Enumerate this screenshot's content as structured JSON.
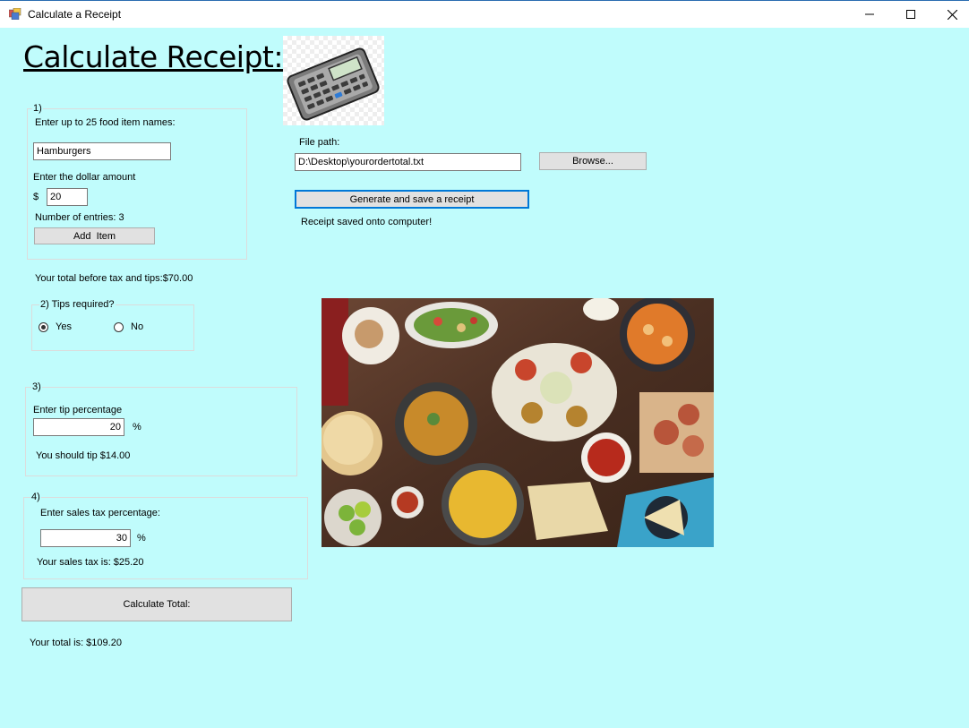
{
  "window": {
    "title": "Calculate a Receipt",
    "minimize_icon": "minimize-icon",
    "maximize_icon": "maximize-icon",
    "close_icon": "close-icon"
  },
  "heading": "Calculate Receipt:",
  "calculator_image": "calculator-icon",
  "section1": {
    "legend": "1)",
    "food_prompt": "Enter up to 25 food item names:",
    "food_value": "Hamburgers",
    "amount_prompt": "Enter the dollar amount",
    "currency_symbol": "$",
    "amount_value": "20",
    "entries_text": "Number of entries: 3",
    "add_button": "Add  Item"
  },
  "total_before": "Your total before tax and tips:$70.00",
  "section2": {
    "legend": "2) Tips required?",
    "yes_label": "Yes",
    "no_label": "No",
    "selected": "Yes"
  },
  "section3": {
    "legend": "3)",
    "tip_prompt": "Enter tip percentage",
    "tip_value": "20",
    "percent_symbol": "%",
    "tip_result": "You should tip $14.00"
  },
  "section4": {
    "legend": "4)",
    "tax_prompt": "Enter sales tax percentage:",
    "tax_value": "30",
    "percent_symbol": "%",
    "tax_result": "Your sales tax is: $25.20"
  },
  "calculate_button": "Calculate Total:",
  "grand_total": "Your total is: $109.20",
  "file": {
    "label": "File path:",
    "path_value": "D:\\Desktop\\yourordertotal.txt",
    "browse_button": "Browse...",
    "generate_button": "Generate and save a receipt",
    "status": "Receipt saved onto computer!"
  },
  "food_image": "food-photo"
}
